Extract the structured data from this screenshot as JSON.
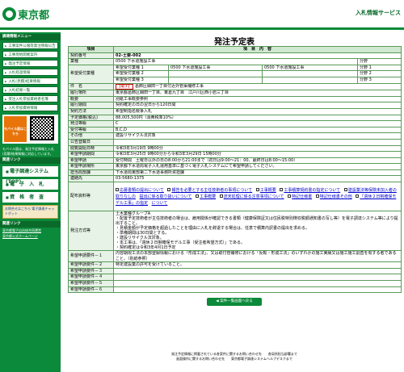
{
  "header": {
    "logo_text": "東京都",
    "service_title": "入札情報サービス"
  },
  "sidebar": {
    "section_1": "調達情報メニュー",
    "items": [
      "工事案件公報等発注情報公告",
      "工事現地開催案内",
      "発注予定情報",
      "入札経過情報",
      "入札(見積)結果情報",
      "入札結果一覧",
      "受注入札参加資格者名簿",
      "入札参加資格情報"
    ],
    "mobile_badge": "モバイル版はこちら",
    "mobile_text": "モバイル版は、発注予定情報と入札(見積)結果情報に対応しています。",
    "section_2": "関連リンク",
    "buttons": [
      "電子調達システム(TOP)",
      "電　子　入　札",
      "資　格　者　査"
    ],
    "bizinfo": "お問合せはこちら 電子調達チャットボット",
    "section_3": "関連リンク",
    "links": [
      "東京都電子自治体共同運営",
      "東京都公式ホームページ"
    ]
  },
  "main": {
    "page_title": "発注予定表",
    "col_item": "項目",
    "col_content": "項　目　内　容",
    "rows": {
      "contract_no_label": "契約番号",
      "contract_no": "02-土要-002",
      "jigyo_label": "業種",
      "jigyo": "0500 下水道施設工事",
      "bunrui_label": "分野",
      "desired_label": "希望受付業種",
      "desired1_label": "希望受付業種 1",
      "desired1_a": "0500 下水道施設工事",
      "desired1_b": "0500 下水道施設工事",
      "desired2_label": "希望受付業種 2",
      "desired3_label": "希望受付業種 3",
      "field1": "分野 1",
      "field2": "分野 2",
      "field3": "分野 3",
      "kenmei_label": "件　名",
      "denshi_tag": "【電子】",
      "kenmei": "葛飾区細田一丁目付近外管渠補修工事",
      "place_label": "履行場所",
      "place": "東京都葛飾区細田一丁目、東葛九丁目　江戸川区西小岩三丁目",
      "gaiyo_label": "概要",
      "gaiyo": "別紙工事概要参照",
      "kikan_label": "履行期間",
      "kikan": "契約確定の日の翌日から120日間",
      "method_label": "契約方法",
      "method": "希望制指名競争入札",
      "price_label": "予定価格(税込)",
      "price": "88,005,500円（消費税率10%）",
      "rank_label": "発注等級",
      "rank": "C",
      "jukyu_label": "受付等級",
      "jukyu": "B,C,D",
      "other_label": "その他",
      "other": "建設リサイクル法対象",
      "kokoku_label": "公告登載日",
      "kokoku": "",
      "open_label": "閲覧開始日時",
      "open": "令和3年3月19日 9時00分",
      "apply_period_label": "希望申請期間",
      "apply_period": "令和3年3月25日 9時00分から令和3年3月29日 15時00分",
      "apply_method_label": "希望申請",
      "apply_method": "受付時間　土曜日以外の日の8:00から21:00まで（初日は9:00〜21：00、最終日は8:00〜15:00）",
      "apply_place_label": "希望申請場所",
      "apply_place": "東京都下水道局電子入札運用基準に基づく電子入札システムにて希望申請してください。",
      "tanto_label": "担当局部課",
      "tanto": "下水道局東部第二下水道事務所资担課",
      "tel_label": "連絡先",
      "tel": "03-5680-1375",
      "files_label": "配布資料等",
      "files": [
        "応募書類の提出について",
        "報告を必要とする主任技術者の事項について",
        "工事概要",
        "工事積算契約書の指定について",
        "建設業法等保険未加入者の取りなしの",
        "提出に係る取り扱いについて",
        "工事概要",
        "流末処理に係る注意事項について",
        "特記仕様書",
        "特記仕様書その他",
        "「週休２日制確保モデル工事」の指定",
        "について"
      ],
      "req_label": "発注方式等",
      "req_lines": [
        "土木業種グループA",
        "・配置予定技術者が主任技術者の場合は、雇用関係が確認できる書類（健康保険証又は住民税特別徴収税額通知書の写し等）を電子調達システム等により提出すること。",
        "・見積金額が予定価格を超過したことを理由に入札を辞退する場合は、任意で積算内訳書の提出を求める。",
        "・準備期間は30日間とする。",
        "・建設リサイクル法対象。",
        "・本工事は、「週休２日制確保モデル工事（受注者希望方式）」である。",
        "・契約確定は令和3年4月1日予定"
      ],
      "cond1_label": "希望申請要件－１",
      "cond1": "内容期限工法の本部登録情報における「形成工法」、又は取付管補修における「反転・形成工法」のいずれかの施工実績又は施工施工調査を有する者であること。（別紙参照）",
      "cond2_label": "希望申請要件－２",
      "cond2": "特定建設業の許可を受けていること。",
      "cond3_label": "希望申請要件－３",
      "cond4_label": "希望申請要件－４",
      "cond5_label": "希望申請要件－５",
      "cond6_label": "希望申請要件－６"
    },
    "back_button": "案件一覧画面へ戻る"
  },
  "footer": {
    "line1": "発注予定情報に掲載されている各案件に関するお問い合わせ先　　各局所担当部署まで",
    "line2": "画面操作に関するお問い合わせ先　　東京都電子調達システムヘルプデスクまで"
  },
  "colors": {
    "brand_green": "#0a8a3a",
    "dark_green": "#0a6a2a",
    "header_cell": "#cfe8cf",
    "label_cell": "#e6f3e6",
    "denshi_red": "#c00000"
  }
}
